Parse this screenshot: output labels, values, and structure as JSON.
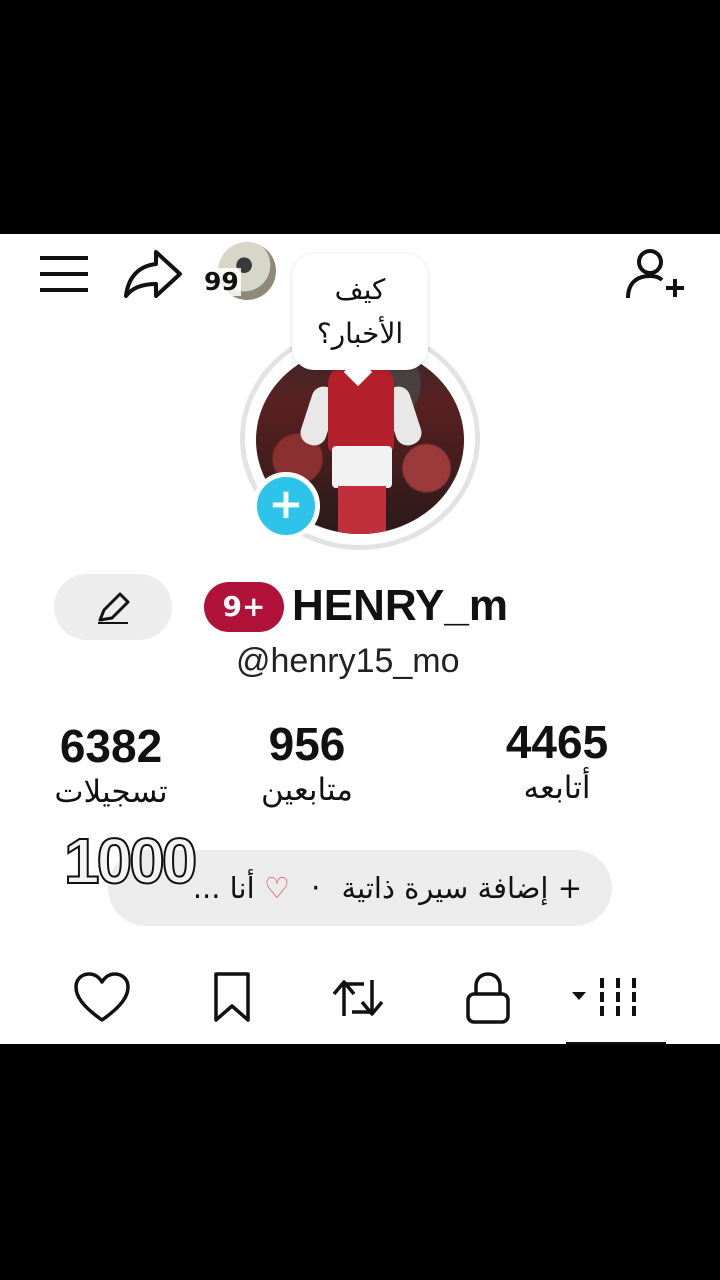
{
  "header": {
    "menu_icon": "hamburger-menu-icon",
    "share_icon": "share-arrow-icon",
    "story_count": "99",
    "add_friend_icon": "person-add-icon"
  },
  "profile": {
    "bubble_text_line1": "كيف",
    "bubble_text_line2": "الأخبار؟",
    "add_story_symbol": "+",
    "notification_badge": "9+",
    "display_name": "HENRY_m",
    "handle": "@henry15_mo"
  },
  "stats": [
    {
      "value": "4465",
      "label": "أتابعه"
    },
    {
      "value": "956",
      "label": "متابعين"
    },
    {
      "value": "6382",
      "label": "تسجيلات"
    }
  ],
  "bio": {
    "add_bio_label": "+ إضافة سيرة ذاتية",
    "separator": "·",
    "status_text": "أنا ...",
    "heart_color": "#e6507a"
  },
  "overlay_text": "1000",
  "tabs": [
    {
      "name": "videos-grid",
      "icon": "grid-icon"
    },
    {
      "name": "private",
      "icon": "lock-icon"
    },
    {
      "name": "reposts",
      "icon": "repost-icon"
    },
    {
      "name": "saved",
      "icon": "bookmark-icon"
    },
    {
      "name": "liked",
      "icon": "heart-outline-icon"
    }
  ],
  "colors": {
    "accent_cyan": "#2ec4ea",
    "badge_red": "#b1123a",
    "background": "#ffffff"
  }
}
